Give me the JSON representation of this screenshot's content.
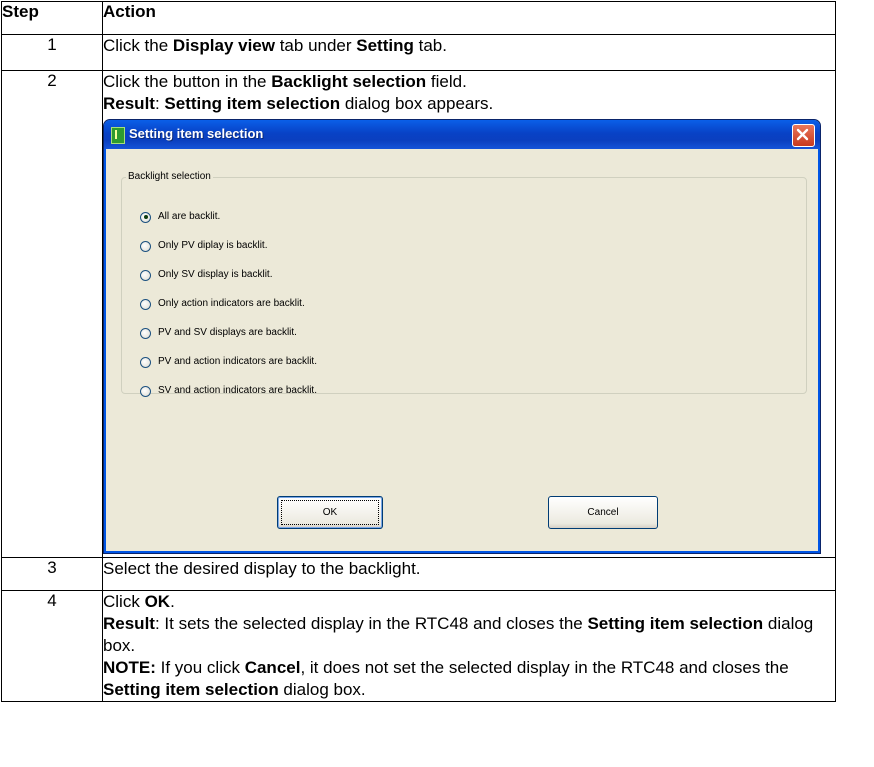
{
  "table": {
    "headers": {
      "step": "Step",
      "action": "Action"
    },
    "rows": [
      {
        "step": "1",
        "p1a": "Click the ",
        "p1b": "Display view",
        "p1c": " tab under ",
        "p1d": "Setting",
        "p1e": " tab."
      },
      {
        "step": "2",
        "p1a": "Click the button in the ",
        "p1b": "Backlight selection",
        "p1c": " field.",
        "p2a": "Result",
        "p2b": ": ",
        "p2c": "Setting item selection",
        "p2d": " dialog box appears."
      },
      {
        "step": "3",
        "p1a": "Select the desired display to the backlight."
      },
      {
        "step": "4",
        "p1a": "Click ",
        "p1b": "OK",
        "p1c": ".",
        "p2a": "Result",
        "p2b": ": It sets the selected display in the RTC48 and closes the ",
        "p2c": "Setting item selection",
        "p2d": " dialog box.",
        "p3a": "NOTE:",
        "p3b": " If you click ",
        "p3c": "Cancel",
        "p3d": ", it does not set the selected display in the RTC48 and closes the ",
        "p3e": "Setting item selection",
        "p3f": " dialog box."
      }
    ]
  },
  "dialog": {
    "title": "Setting item selection",
    "group_label": "Backlight selection",
    "options": [
      {
        "label": "All are backlit.",
        "checked": true
      },
      {
        "label": "Only PV diplay is backlit.",
        "checked": false
      },
      {
        "label": "Only SV display is backlit.",
        "checked": false
      },
      {
        "label": "Only action indicators are backlit.",
        "checked": false
      },
      {
        "label": "PV and SV displays are backlit.",
        "checked": false
      },
      {
        "label": "PV and action indicators are backlit.",
        "checked": false
      },
      {
        "label": "SV and action indicators are backlit.",
        "checked": false
      }
    ],
    "ok_label": "OK",
    "cancel_label": "Cancel"
  }
}
